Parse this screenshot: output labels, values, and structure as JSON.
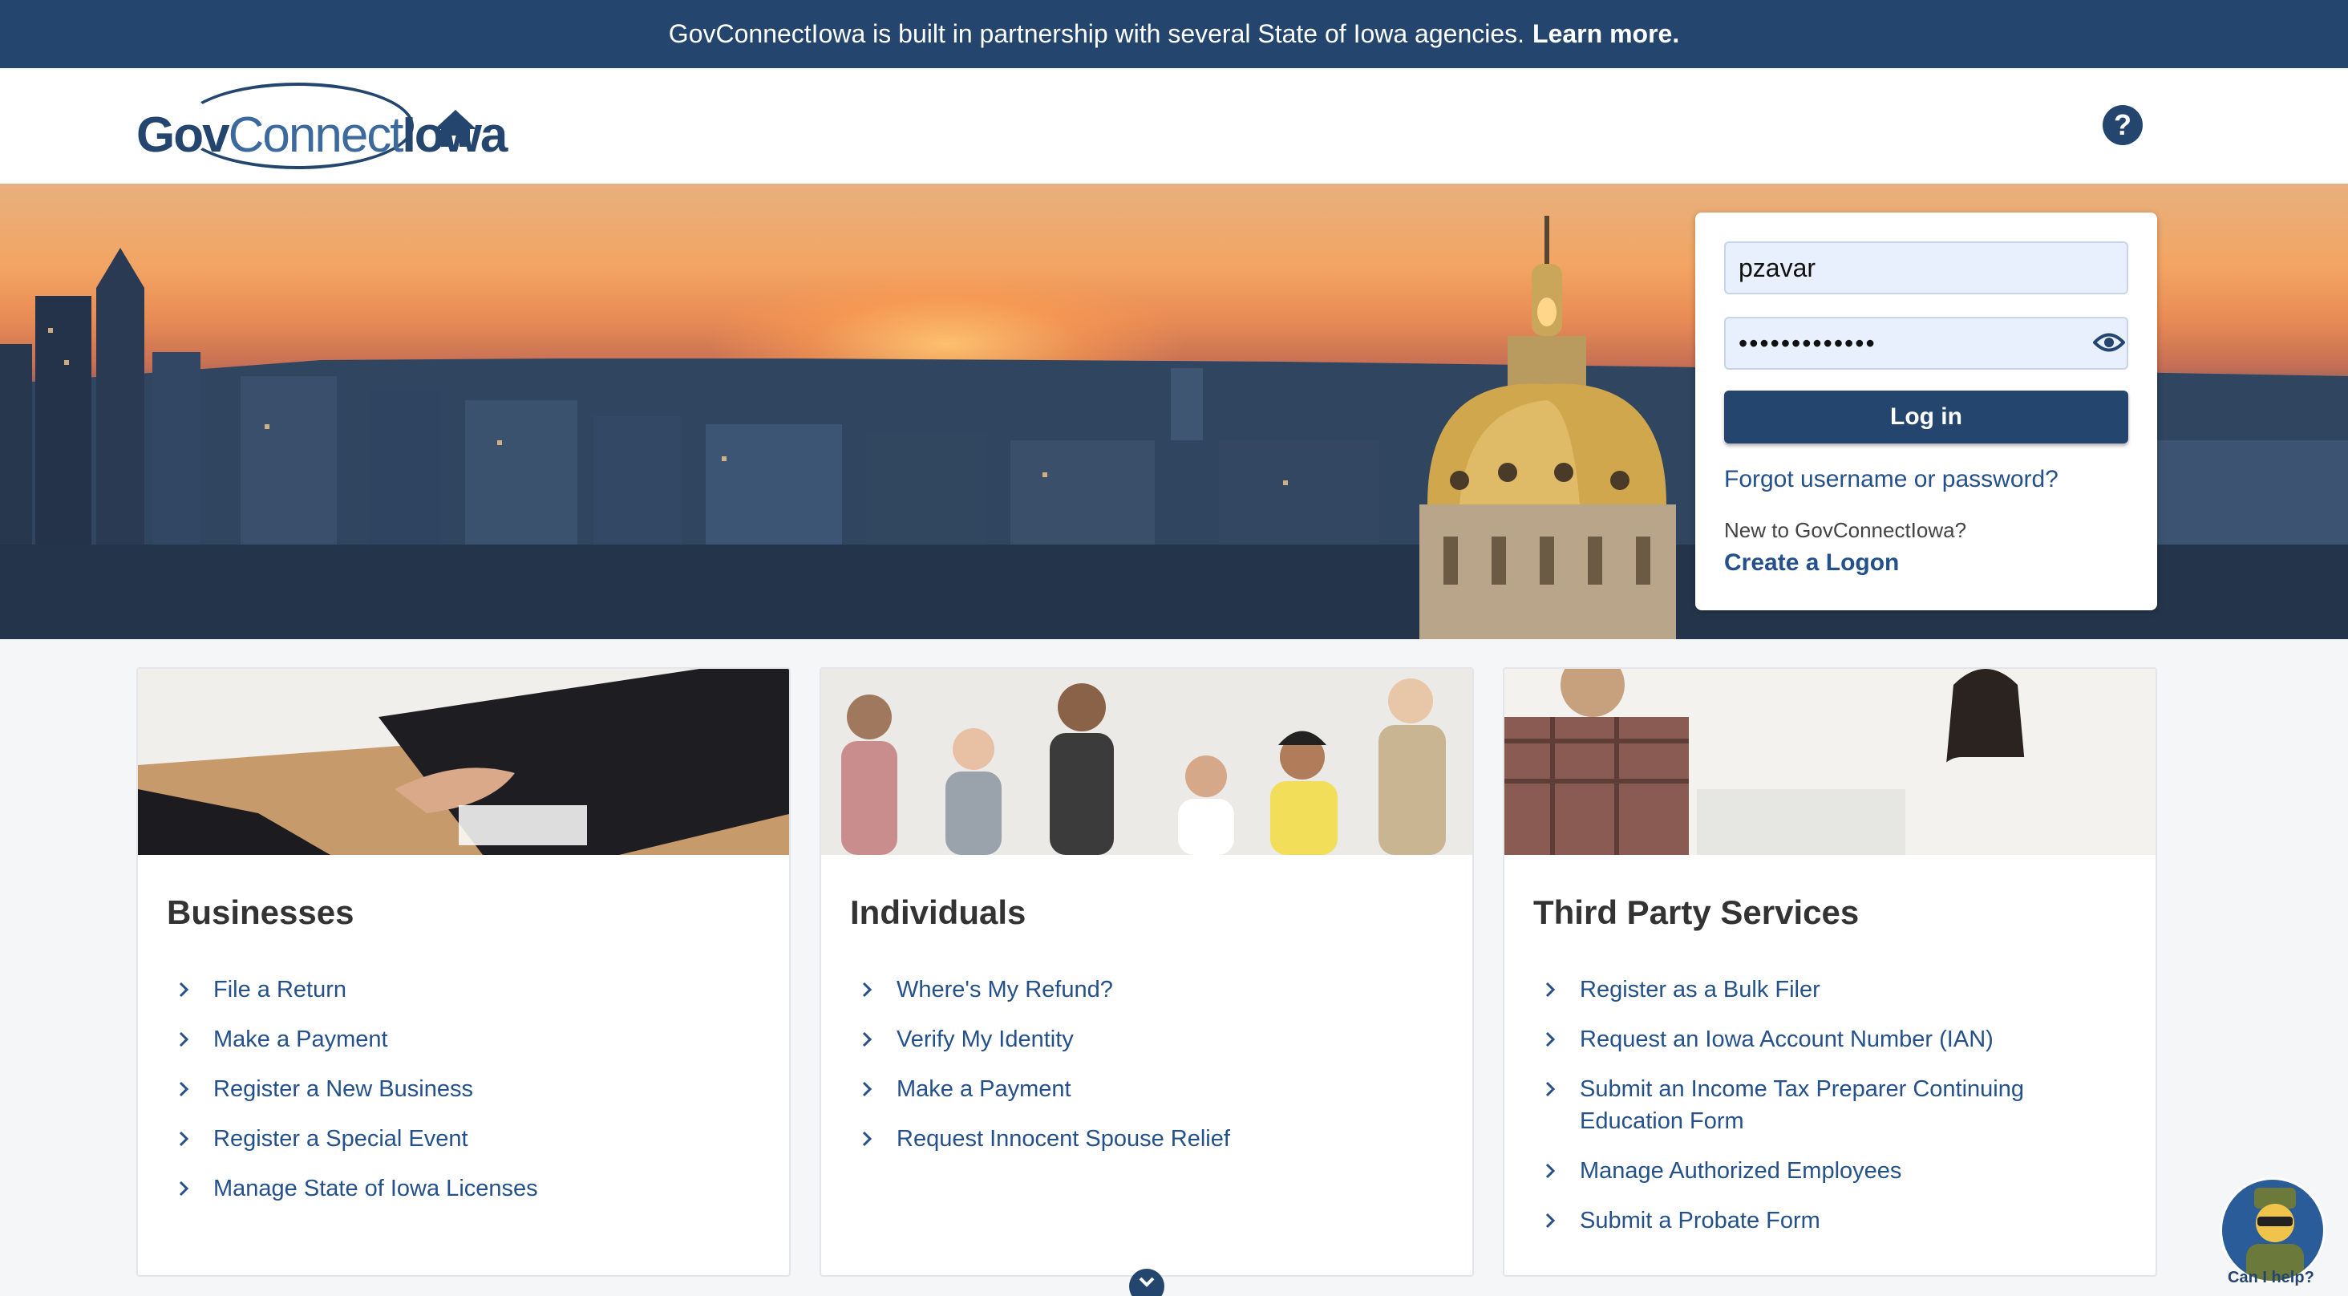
{
  "banner": {
    "text": "GovConnectIowa is built in partnership with several State of Iowa agencies.",
    "link": "Learn more."
  },
  "header": {
    "logo_left": "Gov",
    "logo_mid": "Connect",
    "logo_right": "Iowa",
    "help": "?"
  },
  "login": {
    "username_value": "pzavar",
    "password_value": "•••••••••••••",
    "submit_label": "Log in",
    "forgot_label": "Forgot username or password?",
    "new_to_label": "New to GovConnectIowa?",
    "create_label": "Create a Logon"
  },
  "cards": [
    {
      "title": "Businesses",
      "links": [
        "File a Return",
        "Make a Payment",
        "Register a New Business",
        "Register a Special Event",
        "Manage State of Iowa Licenses"
      ]
    },
    {
      "title": "Individuals",
      "links": [
        "Where's My Refund?",
        "Verify My Identity",
        "Make a Payment",
        "Request Innocent Spouse Relief"
      ]
    },
    {
      "title": "Third Party Services",
      "links": [
        "Register as a Bulk Filer",
        "Request an Iowa Account Number (IAN)",
        "Submit an Income Tax Preparer Continuing Education Form",
        "Manage Authorized Employees",
        "Submit a Probate Form"
      ]
    }
  ],
  "chat": {
    "label": "Can I help?"
  },
  "colors": {
    "brand": "#24466e",
    "link": "#24508c",
    "accent": "#7fcab5"
  }
}
